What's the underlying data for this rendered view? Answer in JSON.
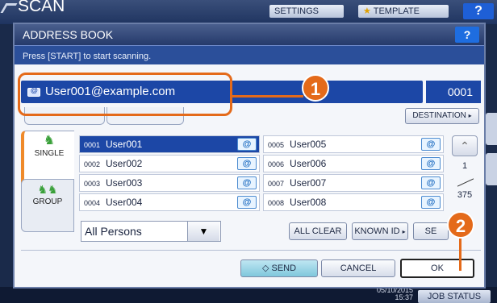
{
  "background": {
    "title": "SCAN",
    "settings_label": "SETTINGS",
    "template_label": "TEMPLATE",
    "help_label": "?",
    "date": "05/10/2015",
    "time": "15:37",
    "job_status_label": "JOB STATUS"
  },
  "dialog": {
    "title": "ADDRESS BOOK",
    "help_label": "?",
    "message": "Press [START] to start scanning.",
    "selected_address": "User001@example.com",
    "selected_count": "0001",
    "destination_label": "DESTINATION",
    "tabs": [
      {
        "label": "SINGLE",
        "icon": "person-icon"
      },
      {
        "label": "GROUP",
        "icon": "group-icon"
      }
    ],
    "entries": [
      {
        "num": "0001",
        "name": "User001",
        "selected": true
      },
      {
        "num": "0002",
        "name": "User002",
        "selected": false
      },
      {
        "num": "0003",
        "name": "User003",
        "selected": false
      },
      {
        "num": "0004",
        "name": "User004",
        "selected": false
      },
      {
        "num": "0005",
        "name": "User005",
        "selected": false
      },
      {
        "num": "0006",
        "name": "User006",
        "selected": false
      },
      {
        "num": "0007",
        "name": "User007",
        "selected": false
      },
      {
        "num": "0008",
        "name": "User008",
        "selected": false
      }
    ],
    "pager": {
      "current": "1",
      "total": "375"
    },
    "filter_value": "All Persons",
    "all_clear_label": "ALL CLEAR",
    "known_id_label": "KNOWN ID",
    "search_label": "SE",
    "send_label": "SEND",
    "cancel_label": "CANCEL",
    "ok_label": "OK"
  },
  "callouts": [
    "1",
    "2"
  ],
  "colors": {
    "accent": "#e46a1a",
    "selection": "#1c47a6",
    "title_bar": "#253a6b"
  }
}
